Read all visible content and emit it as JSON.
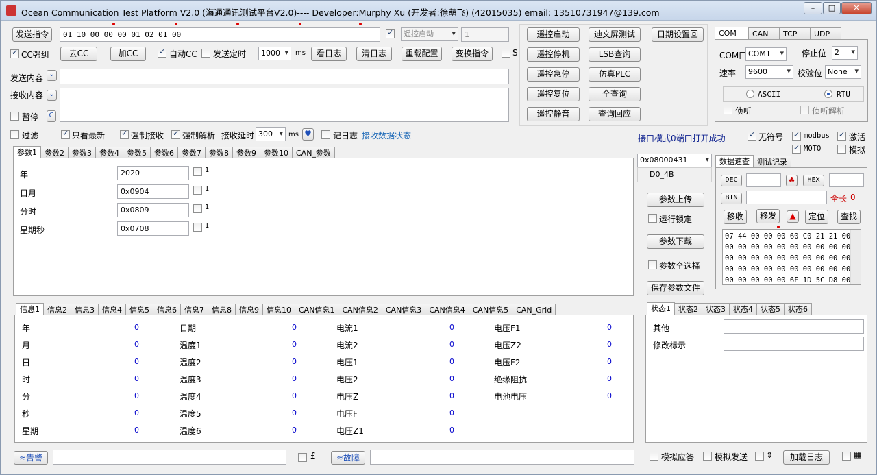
{
  "window": {
    "title": "Ocean Communication Test Platform V2.0 (海通通讯测试平台V2.0)---- Developer:Murphy Xu (开发者:徐萌飞)  (42015035)   email: 13510731947@139.com",
    "min": "–",
    "max": "□",
    "close": "✕"
  },
  "send": {
    "send_cmd_btn": "发送指令",
    "cmd_value": "01 10 00 00 00 01 02 01 00",
    "remote_start_combo": "遥控启动",
    "spin_value": "1"
  },
  "row2": {
    "cc_force": "CC强纠",
    "remove_cc": "去CC",
    "add_cc": "加CC",
    "auto_cc": "自动CC",
    "send_timed": "发送定时",
    "interval": "1000",
    "ms": "ms",
    "view_log": "看日志",
    "clear_log": "清日志",
    "reload_cfg": "重载配置",
    "transform_cmd": "变换指令",
    "s": "S"
  },
  "content": {
    "send_label": "发送内容",
    "recv_label": "接收内容",
    "pause": "暂停",
    "c": "C",
    "send_value": "",
    "recv_value": ""
  },
  "remote": {
    "buttons": [
      "遥控启动",
      "迪文屏测试",
      "日期设置回",
      "遥控停机",
      "LSB查询",
      "遥控急停",
      "仿真PLC",
      "遥控复位",
      "全查询",
      "遥控静音",
      "查询回应"
    ]
  },
  "com": {
    "tabs": [
      "COM",
      "CAN",
      "TCP",
      "UDP"
    ],
    "port_label": "COM口",
    "port": "COM1",
    "stop_label": "停止位",
    "stop": "2",
    "baud_label": "速率",
    "baud": "9600",
    "parity_label": "校验位",
    "parity": "None",
    "ascii": "ASCII",
    "rtu": "RTU",
    "listen": "侦听",
    "listen_parse": "侦听解析"
  },
  "filter": {
    "filter": "过滤",
    "latest": "只看最新",
    "force_recv": "强制接收",
    "force_parse": "强制解析",
    "delay_label": "接收延时",
    "delay": "300",
    "ms": "ms",
    "heart": "♥",
    "log": "记日志",
    "state": "接收数据状态"
  },
  "status_msg": "接口模式0端口打开成功",
  "opts": {
    "unsigned": "无符号",
    "modbus": "modbus",
    "activate": "激活",
    "moto": "MOTO",
    "simulate": "模拟"
  },
  "params": {
    "tabs": [
      "参数1",
      "参数2",
      "参数3",
      "参数4",
      "参数5",
      "参数6",
      "参数7",
      "参数8",
      "参数9",
      "参数10",
      "CAN_参数"
    ],
    "rows": [
      {
        "label": "年",
        "value": "2020",
        "chk": "1"
      },
      {
        "label": "日月",
        "value": "0x0904",
        "chk": "1"
      },
      {
        "label": "分时",
        "value": "0x0809",
        "chk": "1"
      },
      {
        "label": "星期秒",
        "value": "0x0708",
        "chk": "1"
      }
    ]
  },
  "addr": {
    "value": "0x08000431",
    "sub": "D0_4B"
  },
  "side_btns": {
    "upload": "参数上传",
    "run_lock": "运行锁定",
    "download": "参数下载",
    "select_all": "参数全选择",
    "save": "保存参数文件"
  },
  "datatool": {
    "tabs": [
      "数据速查",
      "测试记录"
    ],
    "dec": "DEC",
    "hex": "HEX",
    "bin": "BIN",
    "total_label": "全长",
    "total": "0",
    "move_recv": "移收",
    "move_send": "移发",
    "locate": "定位",
    "find": "查找",
    "hex_lines": [
      "07 44 00 00 00 60 C0 21 21 00",
      "00 00 00 00 00 00 00 00 00 00",
      "00 00 00 00 00 00 00 00 00 00",
      "00 00 00 00 00 00 00 00 00 00",
      "00 00 00 00 00 6F 1D 5C D8 00"
    ]
  },
  "info": {
    "tabs": [
      "信息1",
      "信息2",
      "信息3",
      "信息4",
      "信息5",
      "信息6",
      "信息7",
      "信息8",
      "信息9",
      "信息10",
      "CAN信息1",
      "CAN信息2",
      "CAN信息3",
      "CAN信息4",
      "CAN信息5",
      "CAN_Grid"
    ],
    "col1": [
      {
        "l": "年",
        "v": "0"
      },
      {
        "l": "月",
        "v": "0"
      },
      {
        "l": "日",
        "v": "0"
      },
      {
        "l": "时",
        "v": "0"
      },
      {
        "l": "分",
        "v": "0"
      },
      {
        "l": "秒",
        "v": "0"
      },
      {
        "l": "星期",
        "v": "0"
      }
    ],
    "col2": [
      {
        "l": "日期",
        "v": "0"
      },
      {
        "l": "温度1",
        "v": "0"
      },
      {
        "l": "温度2",
        "v": "0"
      },
      {
        "l": "温度3",
        "v": "0"
      },
      {
        "l": "温度4",
        "v": "0"
      },
      {
        "l": "温度5",
        "v": "0"
      },
      {
        "l": "温度6",
        "v": "0"
      }
    ],
    "col3": [
      {
        "l": "电流1",
        "v": "0"
      },
      {
        "l": "电流2",
        "v": "0"
      },
      {
        "l": "电压1",
        "v": "0"
      },
      {
        "l": "电压2",
        "v": "0"
      },
      {
        "l": "电压Z",
        "v": "0"
      },
      {
        "l": "电压F",
        "v": "0"
      },
      {
        "l": "电压Z1",
        "v": "0"
      }
    ],
    "col4": [
      {
        "l": "电压F1",
        "v": "0"
      },
      {
        "l": "电压Z2",
        "v": "0"
      },
      {
        "l": "电压F2",
        "v": "0"
      },
      {
        "l": "绝缘阻抗",
        "v": "0"
      },
      {
        "l": "电池电压",
        "v": "0"
      }
    ]
  },
  "state": {
    "tabs": [
      "状态1",
      "状态2",
      "状态3",
      "状态4",
      "状态5",
      "状态6"
    ],
    "other": "其他",
    "modify": "修改标示"
  },
  "bottom": {
    "alarm": "≈告警",
    "fault": "≈故障",
    "pound": "£",
    "sim_reply": "模拟应答",
    "sim_send": "模拟发送",
    "arrows": "⇕",
    "load_log": "加载日志"
  }
}
